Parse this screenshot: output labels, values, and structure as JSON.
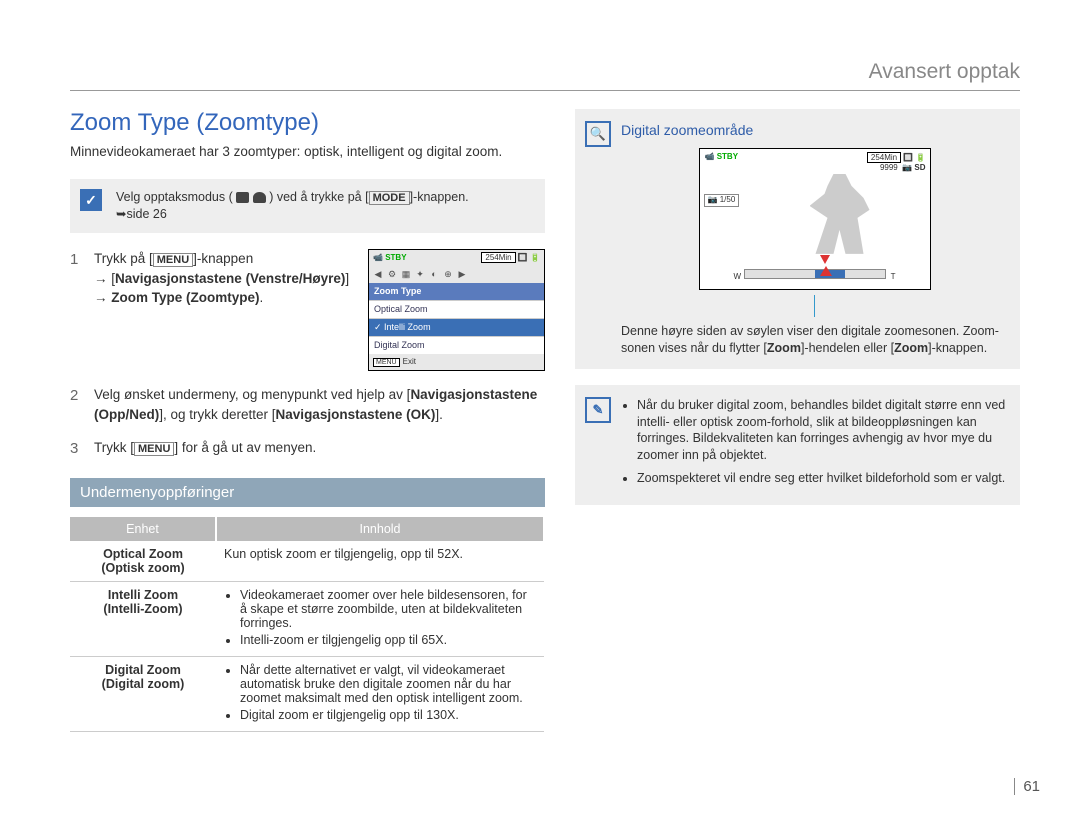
{
  "breadcrumb": "Avansert opptak",
  "title": "Zoom Type (Zoomtype)",
  "intro": "Minnevideokameraet har 3 zoomtyper: optisk, intelligent og digital zoom.",
  "mode_note_prefix": "Velg opptaksmodus (",
  "mode_note_suffix": ") ved å trykke på [",
  "mode_key": "MODE",
  "mode_note_tail": "]-knappen.",
  "mode_note_page": "➥side 26",
  "step1_a": "Trykk på [",
  "step1_menu": "MENU",
  "step1_b": "]-knappen",
  "step1_c": "→ [",
  "step1_nav": "Navigasjonstastene (Venstre/Høyre)",
  "step1_d": "] → ",
  "step1_zoom": "Zoom Type (Zoomtype)",
  "step1_e": ".",
  "step2_a": "Velg ønsket undermeny, og menypunkt ved hjelp av [",
  "step2_nav1": "Navigasjonstastene (Opp/Ned)",
  "step2_b": "], og trykk deretter [",
  "step2_nav2": "Navigasjonstastene (OK)",
  "step2_c": "].",
  "step3_a": "Trykk [",
  "step3_menu": "MENU",
  "step3_b": "] for å gå ut av menyen.",
  "cam_menu": {
    "stby": "STBY",
    "time": "254Min",
    "title": "Zoom Type",
    "items": [
      "Optical Zoom",
      "Intelli Zoom",
      "Digital Zoom"
    ],
    "exit_key": "MENU",
    "exit": "Exit"
  },
  "sub_heading": "Undermenyoppføringer",
  "table": {
    "h1": "Enhet",
    "h2": "Innhold",
    "rows": [
      {
        "unit_a": "Optical Zoom",
        "unit_b": "(Optisk zoom)",
        "content_plain": "Kun optisk zoom er tilgjengelig, opp til 52X."
      },
      {
        "unit_a": "Intelli Zoom",
        "unit_b": "(Intelli-Zoom)",
        "bullets": [
          "Videokameraet zoomer over hele bildesensoren, for å skape et større zoombilde, uten at bildekvaliteten forringes.",
          "Intelli-zoom er tilgjengelig opp til 65X."
        ]
      },
      {
        "unit_a": "Digital Zoom",
        "unit_b": "(Digital zoom)",
        "bullets": [
          "Når dette alternativet er valgt, vil videokameraet automatisk bruke den digitale zoomen når du har zoomet maksimalt med den optisk intelligent zoom.",
          "Digital zoom er tilgjengelig opp til 130X."
        ]
      }
    ]
  },
  "right": {
    "box_title": "Digital zoomeområde",
    "stby": "STBY",
    "time": "254Min",
    "count": "9999",
    "sd": "SD",
    "fraction": "1/50",
    "w": "W",
    "t": "T",
    "caption_a": "Denne høyre siden av søylen viser den digitale zoomesonen. Zoom-sonen vises når du flytter [",
    "caption_zoom": "Zoom",
    "caption_b": "]-hendelen eller [",
    "caption_c": "]-knappen.",
    "info": [
      "Når du bruker digital zoom, behandles bildet digitalt større enn ved intelli- eller optisk zoom-forhold, slik at bildeoppløsningen kan forringes. Bildekvaliteten kan forringes avhengig av hvor mye du zoomer inn på objektet.",
      "Zoomspekteret vil endre seg etter hvilket bildeforhold som er valgt."
    ]
  },
  "page_num": "61"
}
